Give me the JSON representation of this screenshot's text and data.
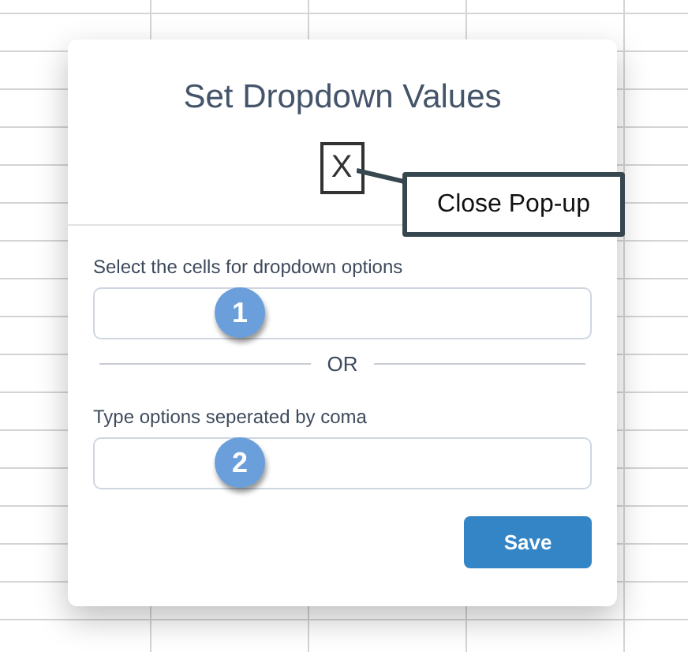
{
  "dialog": {
    "title": "Set Dropdown Values",
    "close_button": "X",
    "fields": [
      {
        "label": "Select the cells for dropdown options",
        "badge": "1"
      },
      {
        "label": "Type options seperated by coma",
        "badge": "2"
      }
    ],
    "separator": "OR",
    "save_button": "Save"
  },
  "callout": {
    "text": "Close Pop-up"
  }
}
